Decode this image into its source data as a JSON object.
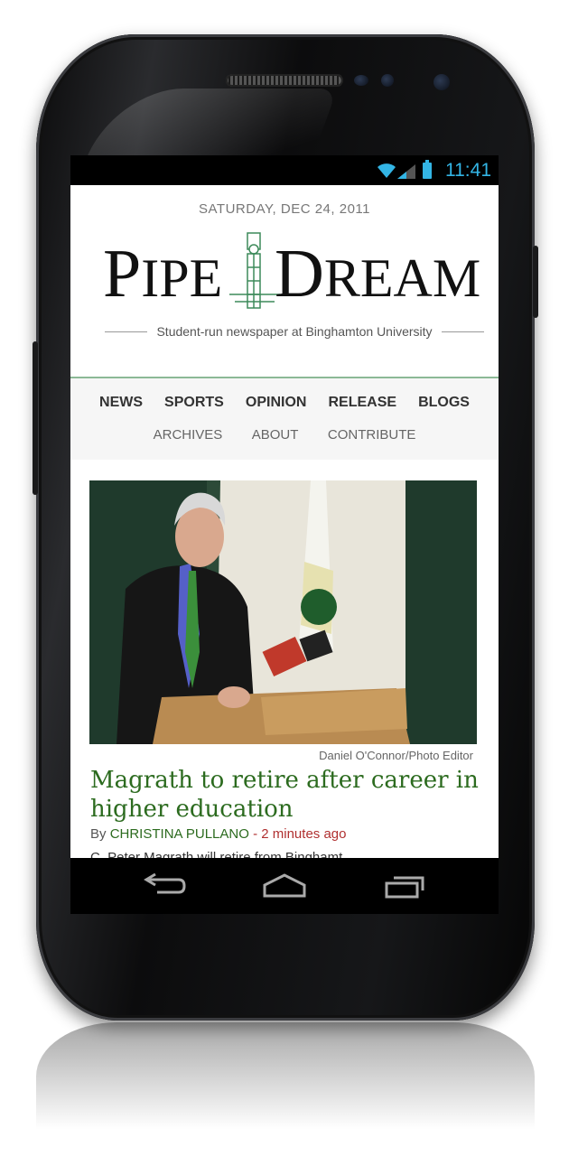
{
  "status_bar": {
    "time": "11:41",
    "icons": [
      "wifi-icon",
      "signal-icon",
      "battery-icon"
    ],
    "accent": "#33b5e5"
  },
  "masthead": {
    "date": "SATURDAY, DEC 24, 2011",
    "logo_word1_first": "P",
    "logo_word1_rest": "IPE",
    "logo_word2_first": "D",
    "logo_word2_rest": "REAM",
    "tagline": "Student-run newspaper at Binghamton University"
  },
  "nav": {
    "primary": [
      "NEWS",
      "SPORTS",
      "OPINION",
      "RELEASE",
      "BLOGS"
    ],
    "secondary": [
      "ARCHIVES",
      "ABOUT",
      "CONTRIBUTE"
    ],
    "accent": "#8cb996"
  },
  "article": {
    "photo_credit": "Daniel O'Connor/Photo Editor",
    "headline": "Magrath to retire after career in higher education",
    "by": "By ",
    "author": "CHRISTINA PULLANO",
    "separator": " - ",
    "time_ago": "2 minutes ago",
    "teaser": "C. Peter Magrath will retire from Binghamt",
    "headline_color": "#2c6b1f",
    "time_color": "#b03030"
  },
  "system_nav": {
    "buttons": [
      "back-icon",
      "home-icon",
      "recent-apps-icon"
    ]
  }
}
